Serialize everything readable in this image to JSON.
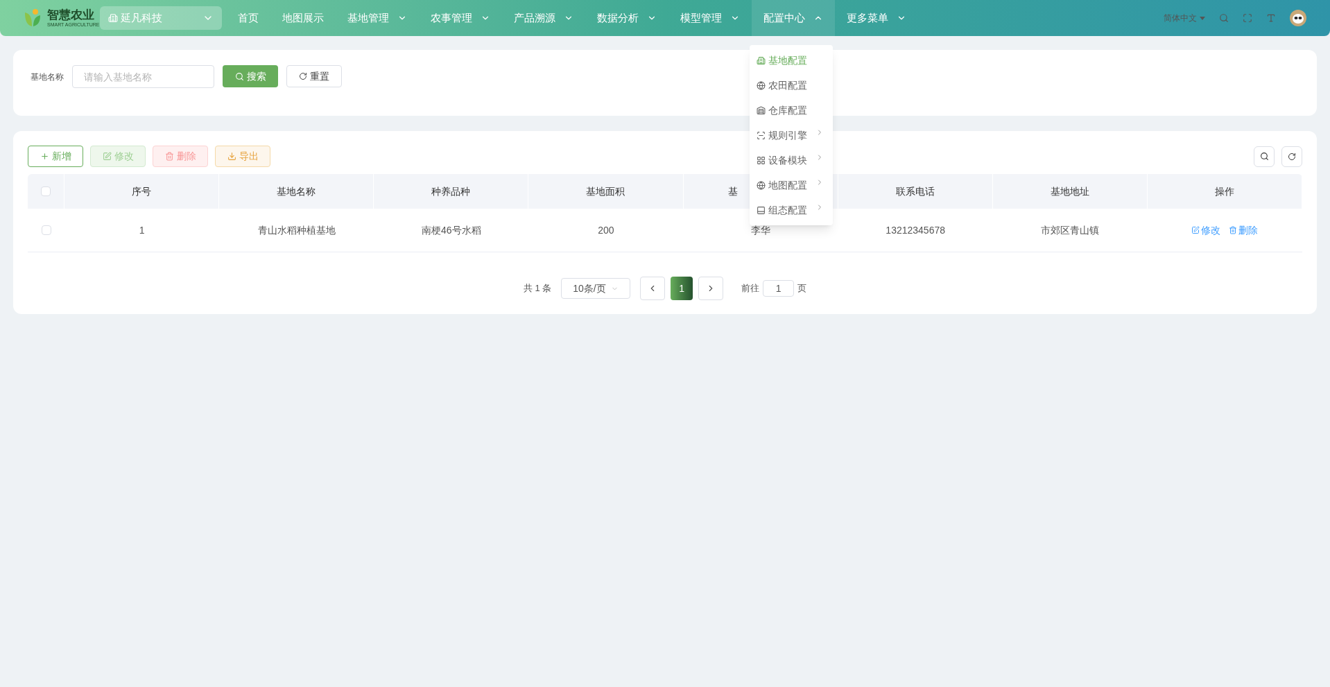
{
  "logo": {
    "title": "智慧农业",
    "subtitle": "SMART AGRICULTURE"
  },
  "org_selector": {
    "value": "延凡科技"
  },
  "nav": [
    {
      "label": "首页",
      "has_caret": false,
      "expanded": false
    },
    {
      "label": "地图展示",
      "has_caret": false,
      "expanded": false
    },
    {
      "label": "基地管理",
      "has_caret": true,
      "expanded": false
    },
    {
      "label": "农事管理",
      "has_caret": true,
      "expanded": false
    },
    {
      "label": "产品溯源",
      "has_caret": true,
      "expanded": false
    },
    {
      "label": "数据分析",
      "has_caret": true,
      "expanded": false
    },
    {
      "label": "模型管理",
      "has_caret": true,
      "expanded": false
    },
    {
      "label": "配置中心",
      "has_caret": true,
      "expanded": true
    },
    {
      "label": "更多菜单",
      "has_caret": true,
      "expanded": false
    }
  ],
  "dropdown": [
    {
      "label": "基地配置",
      "kind": "building",
      "selected": true,
      "has_submenu": false
    },
    {
      "label": "农田配置",
      "kind": "globe",
      "selected": false,
      "has_submenu": false
    },
    {
      "label": "仓库配置",
      "kind": "warehouse",
      "selected": false,
      "has_submenu": false
    },
    {
      "label": "规则引擎",
      "kind": "rule",
      "selected": false,
      "has_submenu": true
    },
    {
      "label": "设备模块",
      "kind": "grid",
      "selected": false,
      "has_submenu": true
    },
    {
      "label": "地图配置",
      "kind": "globe",
      "selected": false,
      "has_submenu": true
    },
    {
      "label": "组态配置",
      "kind": "panel",
      "selected": false,
      "has_submenu": true
    }
  ],
  "language": "简体中文",
  "search_form": {
    "label": "基地名称",
    "placeholder": "请输入基地名称",
    "search_button": "搜索",
    "reset_button": "重置"
  },
  "toolbar": [
    {
      "label": "新增",
      "kind": "add"
    },
    {
      "label": "修改",
      "kind": "edit"
    },
    {
      "label": "删除",
      "kind": "delete"
    },
    {
      "label": "导出",
      "kind": "export"
    }
  ],
  "table": {
    "select_all_checked": false,
    "columns": [
      "序号",
      "基地名称",
      "种养品种",
      "基地面积",
      "基",
      "联系电话",
      "基地地址",
      "操作"
    ],
    "rows": [
      {
        "checked": false,
        "cells": [
          "1",
          "青山水稻种植基地",
          "南梗46号水稻",
          "200",
          "李华",
          "13212345678",
          "市郊区青山镇"
        ],
        "actions": [
          "修改",
          "删除"
        ]
      }
    ]
  },
  "pagination": {
    "total": "共 1 条",
    "page_size": "10条/页",
    "pages": [
      {
        "label": "1",
        "selected": true
      }
    ],
    "goto_label": "前往",
    "goto_value": "1",
    "goto_suffix": "页"
  }
}
